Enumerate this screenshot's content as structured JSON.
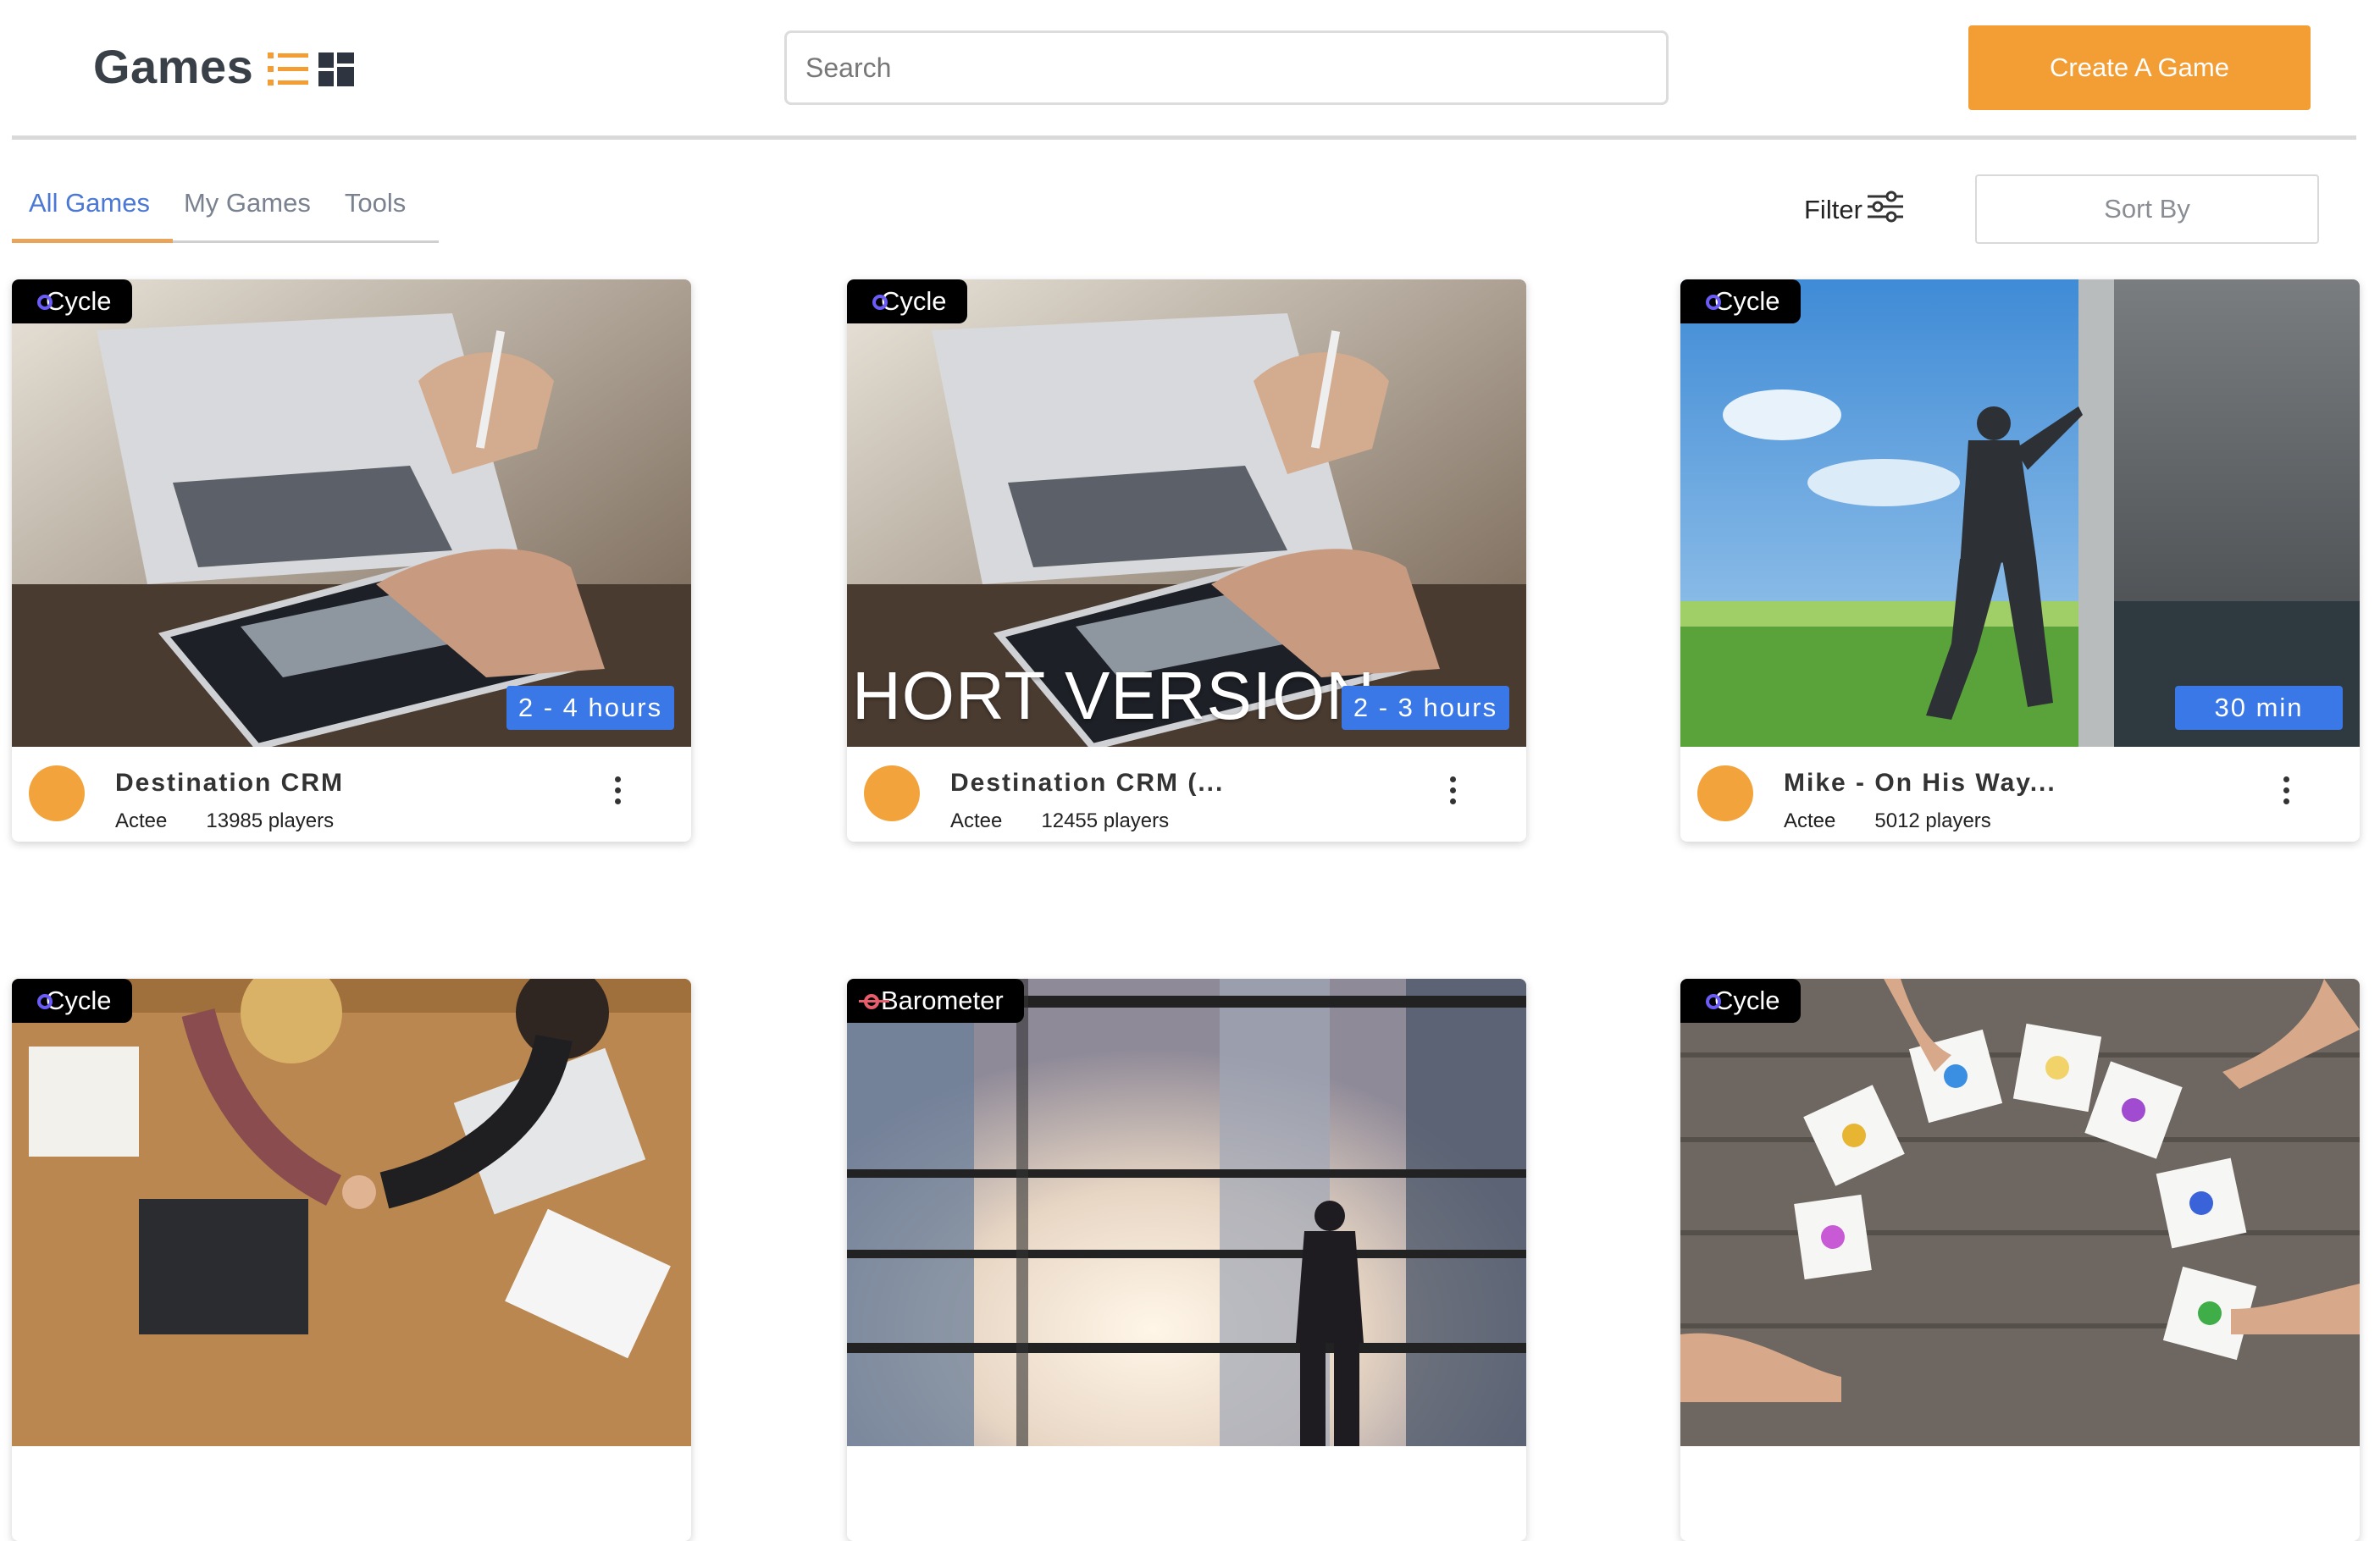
{
  "header": {
    "title": "Games",
    "search_placeholder": "Search",
    "create_label": "Create A Game",
    "accent_color": "#f29e35"
  },
  "tabs": [
    {
      "label": "All Games",
      "active": true
    },
    {
      "label": "My Games",
      "active": false
    },
    {
      "label": "Tools",
      "active": false
    }
  ],
  "toolbar": {
    "filter_label": "Filter",
    "sort_label": "Sort By"
  },
  "cards": [
    {
      "type": "Cycle",
      "type_icon": "cycle-icon",
      "duration": "2 - 4 hours",
      "name": "Destination CRM",
      "author": "Actee",
      "players": "13985 players",
      "image": "laptop-tablet-photo"
    },
    {
      "type": "Cycle",
      "type_icon": "cycle-icon",
      "duration": "2 - 3 hours",
      "name": "Destination CRM (...",
      "author": "Actee",
      "players": "12455 players",
      "image": "laptop-tablet-photo",
      "overlay_text": "HORT VERSION"
    },
    {
      "type": "Cycle",
      "type_icon": "cycle-icon",
      "duration": "30 min",
      "name": "Mike - On His Way...",
      "author": "Actee",
      "players": "5012 players",
      "image": "man-pushing-wall-photo"
    },
    {
      "type": "Cycle",
      "type_icon": "cycle-icon",
      "image": "team-handshake-desk-photo"
    },
    {
      "type": "Barometer",
      "type_icon": "barometer-icon",
      "image": "man-city-window-photo"
    },
    {
      "type": "Cycle",
      "type_icon": "cycle-icon",
      "image": "hands-lightbulb-cards-photo"
    }
  ]
}
